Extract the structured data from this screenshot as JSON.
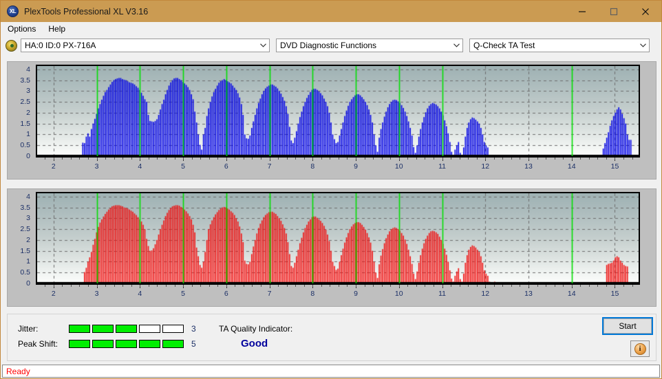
{
  "window": {
    "title": "PlexTools Professional XL V3.16",
    "app_icon": "XL",
    "minimize_icon": "minimize-icon",
    "maximize_icon": "maximize-icon",
    "close_icon": "close-icon"
  },
  "menu": {
    "items": [
      {
        "label": "Options"
      },
      {
        "label": "Help"
      }
    ]
  },
  "selectors": {
    "drive_icon": "disc-drive-icon",
    "drive": {
      "value": "HA:0 ID:0  PX-716A"
    },
    "function": {
      "value": "DVD Diagnostic Functions"
    },
    "test": {
      "value": "Q-Check TA Test"
    },
    "chevron": "chevron-down-icon"
  },
  "results": {
    "jitter_label": "Jitter:",
    "jitter_value": "3",
    "jitter_filled": 3,
    "jitter_total": 5,
    "peak_shift_label": "Peak Shift:",
    "peak_shift_value": "5",
    "peak_shift_filled": 5,
    "peak_shift_total": 5,
    "tqi_label": "TA Quality Indicator:",
    "tqi_value": "Good",
    "start_label": "Start",
    "info_icon": "info-icon",
    "bar_on_color": "#00ef00",
    "bar_off_color": "#ffffff",
    "tqi_color": "#00009c"
  },
  "status": {
    "text": "Ready"
  },
  "chart_data": [
    {
      "type": "bar",
      "name": "jitter-chart",
      "title": "",
      "xlabel": "",
      "ylabel": "",
      "bar_color": "#0000e6",
      "marker_color": "#00e000",
      "xlim": [
        1.62,
        15.55
      ],
      "ylim": [
        0,
        4.15
      ],
      "yticks": [
        0,
        0.5,
        1,
        1.5,
        2,
        2.5,
        3,
        3.5,
        4
      ],
      "ytick_labels": [
        "0",
        "0.5",
        "1",
        "1.5",
        "2",
        "2.5",
        "3",
        "3.5",
        "4"
      ],
      "xticks": [
        2,
        3,
        4,
        5,
        6,
        7,
        8,
        9,
        10,
        11,
        12,
        13,
        14,
        15
      ],
      "xtick_labels": [
        "2",
        "3",
        "4",
        "5",
        "6",
        "7",
        "8",
        "9",
        "10",
        "11",
        "12",
        "13",
        "14",
        "15"
      ],
      "grid": true,
      "markers": [
        3,
        4,
        5,
        6,
        7,
        8,
        9,
        10,
        11,
        14
      ],
      "bar_count": 278,
      "values": [
        0,
        0,
        0,
        0,
        0,
        0,
        0,
        0,
        0,
        0,
        0,
        0,
        0,
        0,
        0,
        0,
        0,
        0,
        0,
        0,
        0.05,
        0.04,
        0,
        0,
        0,
        0,
        0.62,
        0.6,
        0.9,
        1.05,
        0.9,
        1.25,
        1.5,
        1.72,
        1.95,
        2.2,
        2.4,
        2.6,
        2.78,
        2.95,
        3.05,
        3.18,
        3.3,
        3.42,
        3.5,
        3.55,
        3.58,
        3.6,
        3.6,
        3.55,
        3.52,
        3.5,
        3.45,
        3.4,
        3.38,
        3.35,
        3.3,
        3.22,
        3.15,
        3.05,
        2.92,
        2.78,
        2.62,
        2.5,
        1.9,
        1.62,
        1.6,
        1.58,
        1.62,
        1.7,
        1.9,
        2.15,
        2.4,
        2.6,
        2.85,
        3.05,
        3.25,
        3.4,
        3.5,
        3.58,
        3.6,
        3.6,
        3.55,
        3.5,
        3.42,
        3.35,
        3.28,
        3.18,
        3.05,
        2.85,
        2.62,
        2.05,
        1.55,
        1.0,
        0.52,
        0.3,
        1.0,
        1.3,
        1.85,
        2.2,
        2.5,
        2.75,
        2.95,
        3.1,
        3.25,
        3.38,
        3.45,
        3.5,
        3.55,
        3.5,
        3.45,
        3.4,
        3.35,
        3.25,
        3.15,
        3.05,
        2.9,
        2.7,
        2.4,
        1.9,
        1.0,
        0.82,
        0.8,
        0.95,
        1.3,
        1.6,
        1.9,
        2.2,
        2.45,
        2.65,
        2.85,
        3.0,
        3.12,
        3.2,
        3.25,
        3.3,
        3.3,
        3.25,
        3.2,
        3.12,
        3.0,
        2.88,
        2.72,
        2.55,
        2.3,
        1.95,
        1.35,
        0.72,
        0.6,
        0.85,
        1.15,
        1.5,
        1.8,
        2.05,
        2.3,
        2.5,
        2.68,
        2.82,
        2.95,
        3.05,
        3.1,
        3.1,
        3.05,
        2.98,
        2.9,
        2.8,
        2.65,
        2.5,
        2.3,
        2.0,
        1.55,
        1.0,
        0.78,
        0.6,
        0.65,
        0.95,
        1.25,
        1.55,
        1.85,
        2.1,
        2.32,
        2.5,
        2.62,
        2.72,
        2.8,
        2.85,
        2.85,
        2.8,
        2.72,
        2.62,
        2.5,
        2.35,
        2.15,
        1.9,
        1.55,
        1.0,
        0.5,
        0.2,
        0.85,
        1.25,
        1.55,
        1.82,
        2.05,
        2.25,
        2.4,
        2.5,
        2.58,
        2.6,
        2.58,
        2.52,
        2.45,
        2.35,
        2.22,
        2.05,
        1.85,
        1.6,
        1.3,
        0.95,
        0.42,
        0.15,
        0.5,
        0.9,
        1.25,
        1.55,
        1.8,
        2.02,
        2.2,
        2.32,
        2.4,
        2.45,
        2.42,
        2.38,
        2.3,
        2.2,
        2.05,
        1.88,
        1.65,
        1.38,
        1.05,
        0.65,
        0.2,
        0.05,
        0.3,
        0.5,
        0.65,
        0.15,
        0.05,
        0.4,
        0.9,
        1.3,
        1.55,
        1.7,
        1.78,
        1.75,
        1.68,
        1.6,
        1.5,
        1.3,
        1.0,
        0.65,
        0.5,
        0.4,
        0.05,
        0,
        0,
        0,
        0,
        0,
        0,
        0,
        0,
        0,
        0,
        0,
        0,
        0,
        0,
        0,
        0,
        0,
        0,
        0,
        0,
        0,
        0,
        0,
        0,
        0,
        0,
        0,
        0,
        0,
        0,
        0,
        0,
        0,
        0,
        0,
        0,
        0,
        0,
        0,
        0,
        0,
        0,
        0,
        0,
        0,
        0,
        0,
        0,
        0,
        0,
        0,
        0,
        0,
        0,
        0,
        0,
        0,
        0,
        0,
        0,
        0,
        0,
        0,
        0,
        0,
        0.35,
        0.6,
        0.85,
        1.1,
        1.4,
        1.65,
        1.85,
        2.0,
        2.15,
        2.25,
        2.15,
        1.95,
        1.75,
        1.5,
        1.0,
        0.75,
        0.75,
        0,
        0,
        0,
        0
      ]
    },
    {
      "type": "bar",
      "name": "peak-shift-chart",
      "title": "",
      "xlabel": "",
      "ylabel": "",
      "bar_color": "#f01010",
      "marker_color": "#00e000",
      "xlim": [
        1.62,
        15.55
      ],
      "ylim": [
        0,
        4.15
      ],
      "yticks": [
        0,
        0.5,
        1,
        1.5,
        2,
        2.5,
        3,
        3.5,
        4
      ],
      "ytick_labels": [
        "0",
        "0.5",
        "1",
        "1.5",
        "2",
        "2.5",
        "3",
        "3.5",
        "4"
      ],
      "xticks": [
        2,
        3,
        4,
        5,
        6,
        7,
        8,
        9,
        10,
        11,
        12,
        13,
        14,
        15
      ],
      "xtick_labels": [
        "2",
        "3",
        "4",
        "5",
        "6",
        "7",
        "8",
        "9",
        "10",
        "11",
        "12",
        "13",
        "14",
        "15"
      ],
      "grid": true,
      "markers": [
        3,
        4,
        5,
        6,
        7,
        8,
        9,
        10,
        11,
        14
      ],
      "bar_count": 278,
      "values": [
        0,
        0,
        0,
        0,
        0,
        0,
        0,
        0,
        0,
        0,
        0,
        0,
        0,
        0,
        0,
        0,
        0,
        0,
        0,
        0,
        0,
        0,
        0,
        0,
        0,
        0,
        0,
        0.52,
        0.72,
        1.0,
        1.2,
        1.45,
        1.78,
        2.05,
        2.35,
        2.6,
        2.8,
        2.95,
        3.08,
        3.2,
        3.3,
        3.4,
        3.48,
        3.55,
        3.58,
        3.6,
        3.6,
        3.6,
        3.58,
        3.55,
        3.5,
        3.48,
        3.45,
        3.4,
        3.35,
        3.3,
        3.22,
        3.15,
        3.05,
        2.95,
        2.85,
        2.7,
        2.5,
        2.05,
        1.72,
        1.5,
        1.52,
        1.62,
        1.8,
        2.0,
        2.25,
        2.5,
        2.7,
        2.9,
        3.1,
        3.25,
        3.38,
        3.48,
        3.55,
        3.58,
        3.6,
        3.6,
        3.58,
        3.52,
        3.48,
        3.4,
        3.32,
        3.22,
        3.1,
        2.95,
        2.7,
        2.35,
        1.65,
        1.25,
        0.85,
        0.72,
        1.0,
        1.45,
        2.0,
        2.5,
        2.72,
        2.9,
        3.05,
        3.18,
        3.28,
        3.38,
        3.45,
        3.5,
        3.52,
        3.5,
        3.45,
        3.4,
        3.32,
        3.25,
        3.15,
        3.0,
        2.85,
        2.62,
        2.3,
        1.9,
        1.05,
        0.9,
        0.88,
        1.0,
        1.35,
        1.7,
        2.0,
        2.3,
        2.55,
        2.75,
        2.9,
        3.05,
        3.15,
        3.22,
        3.28,
        3.3,
        3.3,
        3.25,
        3.2,
        3.1,
        3.0,
        2.88,
        2.72,
        2.55,
        2.3,
        1.9,
        1.35,
        0.8,
        0.72,
        0.95,
        1.25,
        1.55,
        1.85,
        2.1,
        2.35,
        2.55,
        2.7,
        2.85,
        2.95,
        3.05,
        3.08,
        3.08,
        3.02,
        2.95,
        2.88,
        2.78,
        2.65,
        2.48,
        2.25,
        1.95,
        1.5,
        1.0,
        0.8,
        0.62,
        0.68,
        1.0,
        1.3,
        1.6,
        1.88,
        2.12,
        2.32,
        2.5,
        2.62,
        2.72,
        2.78,
        2.82,
        2.82,
        2.78,
        2.7,
        2.6,
        2.48,
        2.32,
        2.12,
        1.88,
        1.5,
        1.0,
        0.5,
        0.25,
        0.88,
        1.28,
        1.58,
        1.85,
        2.08,
        2.25,
        2.4,
        2.5,
        2.55,
        2.58,
        2.55,
        2.5,
        2.42,
        2.32,
        2.2,
        2.02,
        1.82,
        1.55,
        1.25,
        0.9,
        0.45,
        0.2,
        0.55,
        0.95,
        1.3,
        1.6,
        1.85,
        2.05,
        2.2,
        2.32,
        2.4,
        2.42,
        2.4,
        2.35,
        2.28,
        2.15,
        2.0,
        1.82,
        1.6,
        1.32,
        1.0,
        0.6,
        0.22,
        0.08,
        0.35,
        0.55,
        0.7,
        0.2,
        0.08,
        0.45,
        0.95,
        1.3,
        1.55,
        1.68,
        1.75,
        1.72,
        1.65,
        1.55,
        1.45,
        1.25,
        0.95,
        0.6,
        0.45,
        0.35,
        0.08,
        0,
        0,
        0.08,
        0,
        0,
        0,
        0,
        0,
        0,
        0,
        0,
        0,
        0,
        0,
        0,
        0,
        0,
        0,
        0,
        0,
        0,
        0,
        0,
        0,
        0,
        0,
        0,
        0,
        0,
        0,
        0,
        0,
        0,
        0,
        0,
        0,
        0,
        0,
        0,
        0,
        0,
        0,
        0,
        0,
        0,
        0,
        0,
        0,
        0,
        0,
        0,
        0,
        0,
        0,
        0,
        0,
        0,
        0,
        0,
        0,
        0,
        0,
        0,
        0,
        0,
        0,
        0,
        0.85,
        0.9,
        0.92,
        0.95,
        1.05,
        1.2,
        1.25,
        1.2,
        1.05,
        0.95,
        0.85,
        0.8,
        0.78,
        0,
        0,
        0,
        0,
        0,
        0
      ]
    }
  ]
}
